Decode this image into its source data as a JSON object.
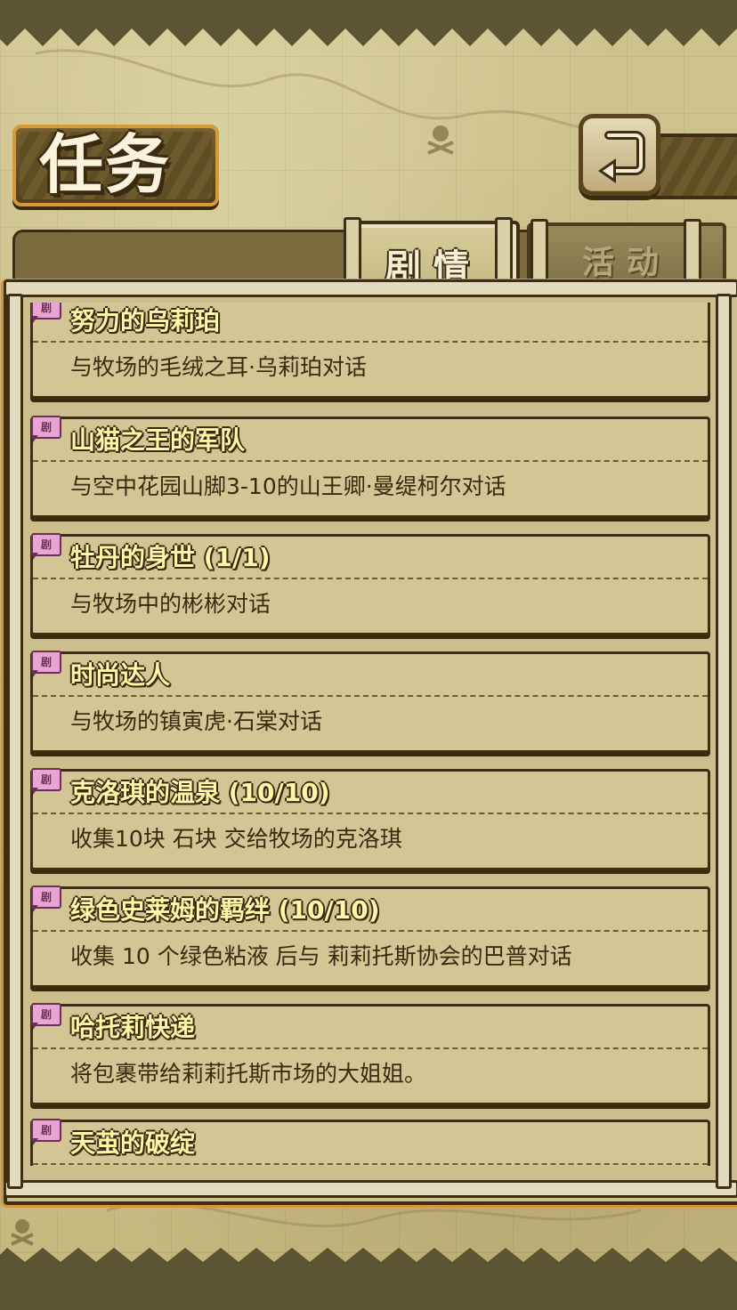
{
  "header": {
    "title": "任务",
    "back_icon": "back-arrow-icon"
  },
  "tabs": [
    {
      "label": "剧情",
      "active": true
    },
    {
      "label": "活动",
      "active": false
    }
  ],
  "quest_badge_label": "剧",
  "quests": [
    {
      "title": "努力的乌莉珀",
      "desc": "与牧场的毛绒之耳·乌莉珀对话"
    },
    {
      "title": "山猫之王的军队",
      "desc": "与空中花园山脚3-10的山王卿·曼缇柯尔对话"
    },
    {
      "title": "牡丹的身世 (1/1)",
      "desc": "与牧场中的彬彬对话"
    },
    {
      "title": "时尚达人",
      "desc": "与牧场的镇寅虎·石棠对话"
    },
    {
      "title": "克洛琪的温泉 (10/10)",
      "desc": "收集10块 石块 交给牧场的克洛琪"
    },
    {
      "title": "绿色史莱姆的羁绊 (10/10)",
      "desc": "收集 10 个绿色粘液 后与 莉莉托斯协会的巴普对话"
    },
    {
      "title": "哈托莉快递",
      "desc": "将包裹带给莉莉托斯市场的大姐姐。"
    },
    {
      "title": "天茧的破绽",
      "desc": ""
    }
  ],
  "colors": {
    "parchment": "#cdbf8d",
    "frame_dark": "#3e2f14",
    "title_text": "#fff6a8",
    "accent_orange": "#d4953d",
    "badge_pink": "#e8a5d2"
  }
}
